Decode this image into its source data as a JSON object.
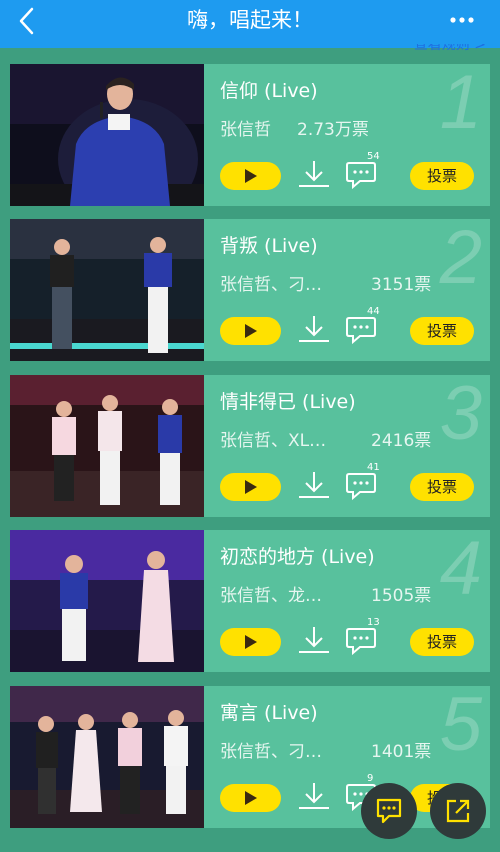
{
  "header": {
    "title": "嗨，唱起来！",
    "rules_link": "查看规则 >"
  },
  "songs": [
    {
      "rank": "1",
      "title": "信仰 (Live)",
      "artist": "张信哲",
      "votes": "2.73万票",
      "comments": "54",
      "vote_label": "投票"
    },
    {
      "rank": "2",
      "title": "背叛 (Live)",
      "artist": "张信哲、刁…",
      "votes": "3151票",
      "comments": "44",
      "vote_label": "投票"
    },
    {
      "rank": "3",
      "title": "情非得已 (Live)",
      "artist": "张信哲、XL…",
      "votes": "2416票",
      "comments": "41",
      "vote_label": "投票"
    },
    {
      "rank": "4",
      "title": "初恋的地方 (Live)",
      "artist": "张信哲、龙…",
      "votes": "1505票",
      "comments": "13",
      "vote_label": "投票"
    },
    {
      "rank": "5",
      "title": "寓言 (Live)",
      "artist": "张信哲、刁…",
      "votes": "1401票",
      "comments": "9",
      "vote_label": "投票"
    }
  ],
  "colors": {
    "header": "#1e9bf0",
    "background": "#3e9e7f",
    "card": "#58c19d",
    "button": "#ffe100"
  },
  "icons": {
    "back": "chevron-left-icon",
    "more": "more-dots-icon",
    "play": "play-icon",
    "download": "download-icon",
    "comment": "comment-icon",
    "chat": "chat-icon",
    "share": "share-icon"
  }
}
